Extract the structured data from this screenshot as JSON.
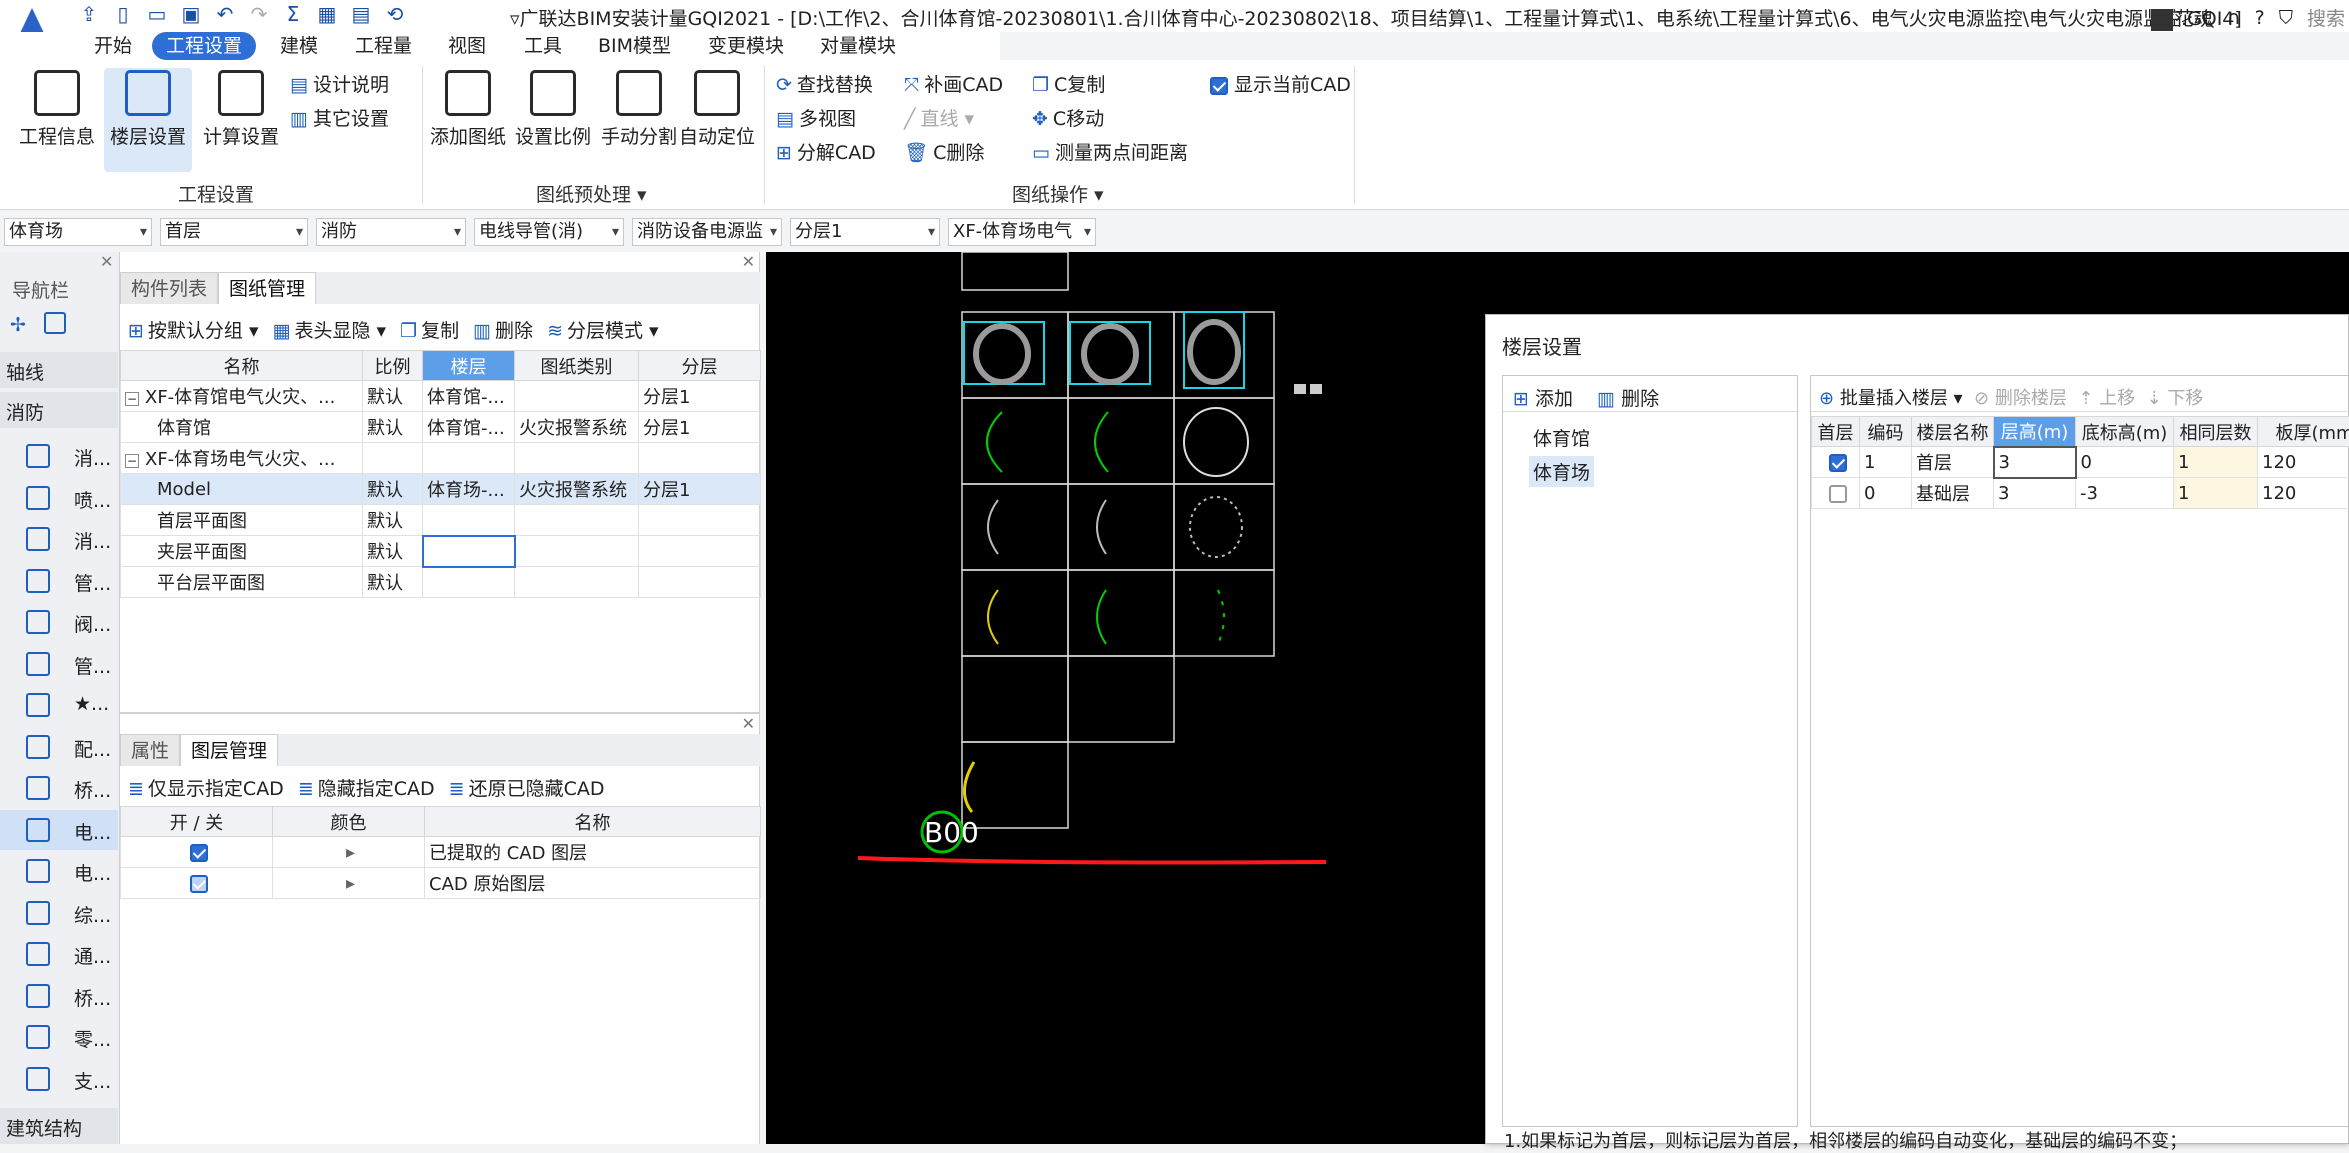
{
  "titlebar": {
    "title": "▿广联达BIM安装计量GQI2021 - [D:\\工作\\2、合川体育馆-20230801\\1.合川体育中心-20230802\\18、项目结算\\1、工程量计算式\\1、电系统\\工程量计算式\\6、电气火灾电源监控\\电气火灾电源监控.GQI4]",
    "user": "花魂",
    "help": "?",
    "search": "搜索"
  },
  "menu": [
    "开始",
    "工程设置",
    "建模",
    "工程量",
    "视图",
    "工具",
    "BIM模型",
    "变更模块",
    "对量模块"
  ],
  "menu_active": "工程设置",
  "ribbon": {
    "big": {
      "project_info": "工程信息",
      "floor_settings": "楼层设置",
      "calc_settings": "计算设置",
      "add_drawing": "添加图纸",
      "set_scale": "设置比例",
      "manual_split": "手动分割",
      "auto_locate": "自动定位"
    },
    "small": {
      "design_notes": "设计说明",
      "other_settings": "其它设置",
      "find_replace": "查找替换",
      "multi_view": "多视图",
      "explode_cad": "分解CAD",
      "redraw_cad": "补画CAD",
      "line": "直线",
      "c_delete": "C删除",
      "c_copy": "C复制",
      "c_move": "C移动",
      "measure": "测量两点间距离",
      "show_current_cad": "显示当前CAD"
    },
    "groups": {
      "project_settings": "工程设置",
      "drawing_preprocess": "图纸预处理 ▾",
      "drawing_ops": "图纸操作 ▾"
    }
  },
  "filters": [
    "体育场",
    "首层",
    "消防",
    "电线导管(消)",
    "消防设备电源监",
    "分层1",
    "XF-体育场电气"
  ],
  "nav": {
    "title": "导航栏",
    "axis": "轴线",
    "fire": "消防",
    "bottom": "建筑结构",
    "items": [
      "消...",
      "喷...",
      "消...",
      "管...",
      "阀...",
      "管...",
      "★...",
      "配...",
      "桥...",
      "电...",
      "电...",
      "综...",
      "通...",
      "桥...",
      "零...",
      "支..."
    ]
  },
  "drawing_panel": {
    "tabs": [
      "构件列表",
      "图纸管理"
    ],
    "toolbar": [
      "按默认分组 ▾",
      "表头显隐 ▾",
      "复制",
      "删除",
      "分层模式 ▾"
    ],
    "headers": [
      "名称",
      "比例",
      "楼层",
      "图纸类别",
      "分层"
    ],
    "rows": [
      {
        "name": "XF-体育馆电气火灾、...",
        "scale": "默认",
        "floor": "体育馆-...",
        "category": "",
        "layer": "分层1",
        "group": true
      },
      {
        "name": "体育馆",
        "scale": "默认",
        "floor": "体育馆-...",
        "category": "火灾报警系统",
        "layer": "分层1",
        "group": false
      },
      {
        "name": "XF-体育场电气火灾、...",
        "scale": "",
        "floor": "",
        "category": "",
        "layer": "",
        "group": true
      },
      {
        "name": "Model",
        "scale": "默认",
        "floor": "体育场-...",
        "category": "火灾报警系统",
        "layer": "分层1",
        "group": false
      },
      {
        "name": "首层平面图",
        "scale": "默认",
        "floor": "",
        "category": "",
        "layer": "",
        "group": false
      },
      {
        "name": "夹层平面图",
        "scale": "默认",
        "floor": "",
        "category": "",
        "layer": "",
        "group": false
      },
      {
        "name": "平台层平面图",
        "scale": "默认",
        "floor": "",
        "category": "",
        "layer": "",
        "group": false
      }
    ]
  },
  "layer_panel": {
    "tabs": [
      "属性",
      "图层管理"
    ],
    "toolbar": [
      "仅显示指定CAD",
      "隐藏指定CAD",
      "还原已隐藏CAD"
    ],
    "headers": [
      "开 / 关",
      "颜色",
      "名称"
    ],
    "rows": [
      {
        "on": true,
        "name": "已提取的 CAD 图层"
      },
      {
        "on": true,
        "name": "CAD 原始图层"
      }
    ]
  },
  "canvas_label": "B00",
  "floor_dialog": {
    "title": "楼层设置",
    "add": "添加",
    "delete": "删除",
    "buildings": [
      "体育馆",
      "体育场"
    ],
    "selected_building": "体育场",
    "toolbar": [
      "批量插入楼层 ▾",
      "删除楼层",
      "上移",
      "下移"
    ],
    "headers": [
      "首层",
      "编码",
      "楼层名称",
      "层高(m)",
      "底标高(m)",
      "相同层数",
      "板厚(mm"
    ],
    "rows": [
      {
        "first": true,
        "code": "1",
        "name": "首层",
        "height": "3",
        "bottom": "0",
        "same": "1",
        "thick": "120"
      },
      {
        "first": false,
        "code": "0",
        "name": "基础层",
        "height": "3",
        "bottom": "-3",
        "same": "1",
        "thick": "120"
      }
    ],
    "note": "1.如果标记为首层，则标记层为首层，相邻楼层的编码自动变化，基础层的编码不变；"
  }
}
